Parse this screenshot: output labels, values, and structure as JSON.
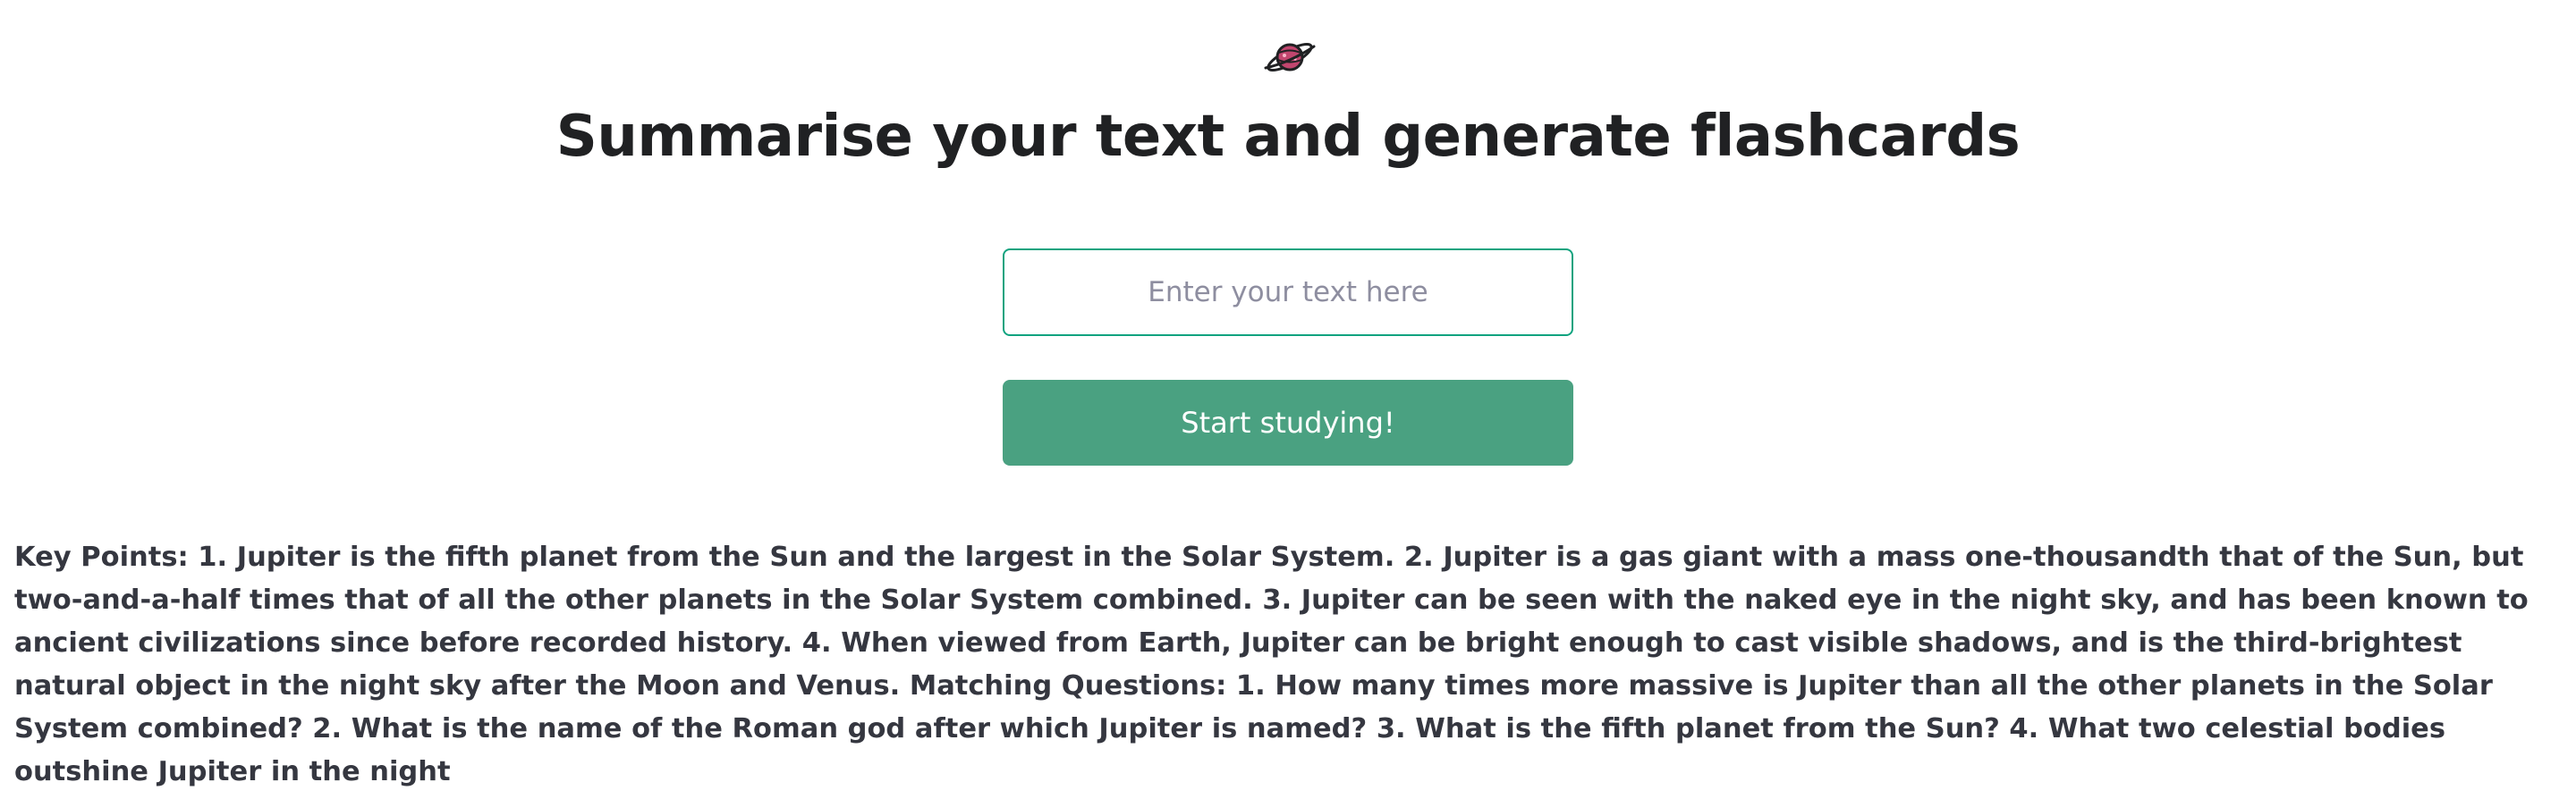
{
  "header": {
    "logo_icon": "planet-icon",
    "logo_color": "#c2466f",
    "title": "Summarise your text and generate flashcards"
  },
  "form": {
    "input_placeholder": "Enter your text here",
    "input_value": "",
    "submit_label": "Start studying!",
    "accent_color": "#10a37f",
    "button_color": "#4aa181"
  },
  "result": {
    "text": "Key Points: 1. Jupiter is the fifth planet from the Sun and the largest in the Solar System. 2. Jupiter is a gas giant with a mass one-thousandth that of the Sun, but two-and-a-half times that of all the other planets in the Solar System combined. 3. Jupiter can be seen with the naked eye in the night sky, and has been known to ancient civilizations since before recorded history. 4. When viewed from Earth, Jupiter can be bright enough to cast visible shadows, and is the third-brightest natural object in the night sky after the Moon and Venus. Matching Questions: 1. How many times more massive is Jupiter than all the other planets in the Solar System combined? 2. What is the name of the Roman god after which Jupiter is named? 3. What is the fifth planet from the Sun? 4. What two celestial bodies outshine Jupiter in the night"
  }
}
